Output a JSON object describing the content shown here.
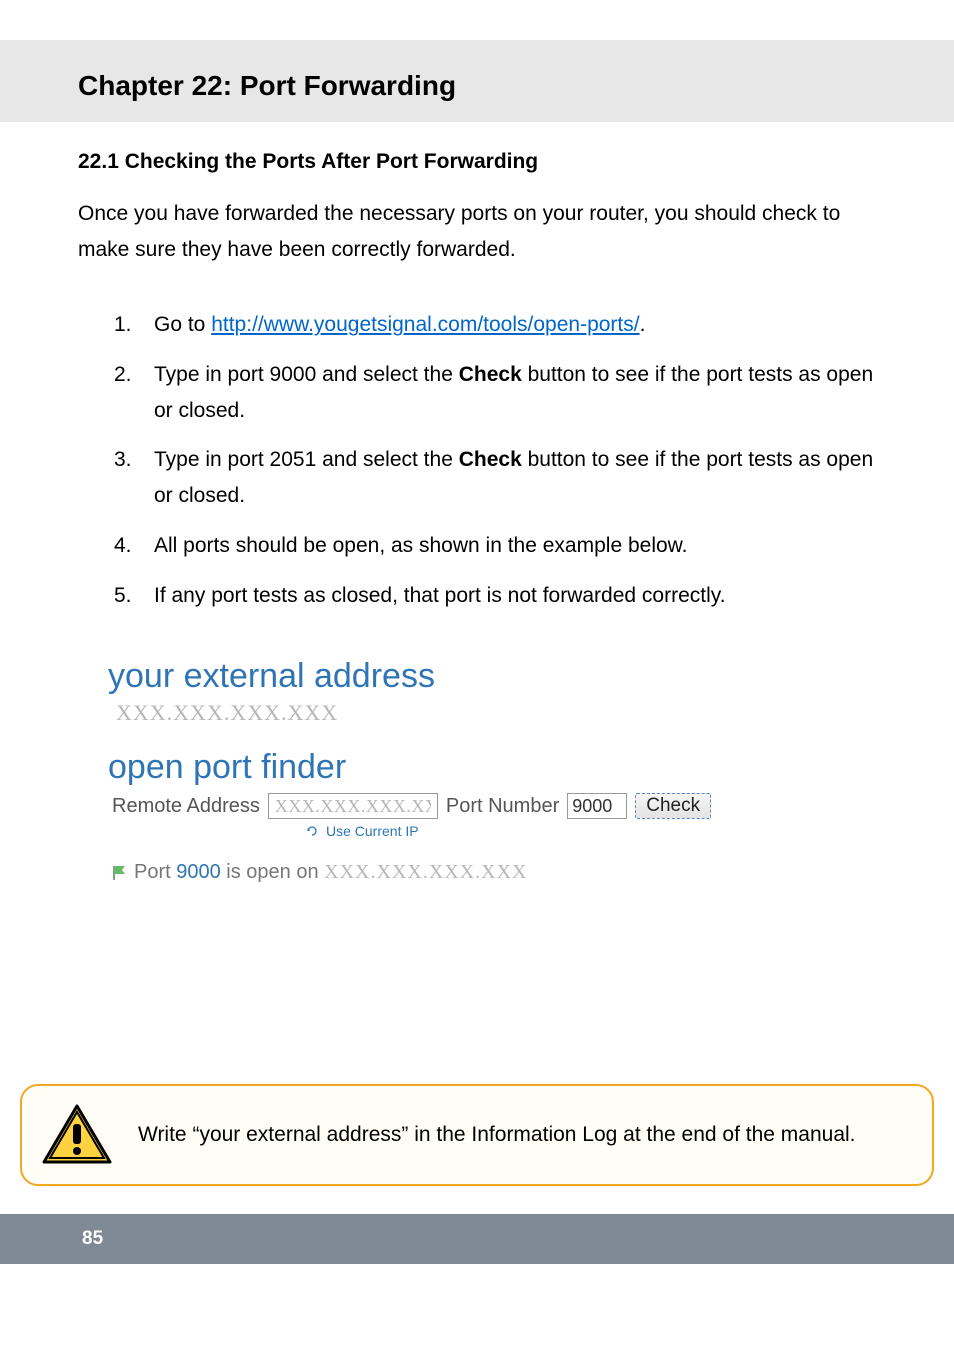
{
  "chapter": {
    "title": "Chapter 22: Port Forwarding"
  },
  "section": {
    "title": "22.1 Checking the Ports After Port Forwarding",
    "intro": "Once you have forwarded the necessary ports on your router, you should check to make sure they have been correctly forwarded."
  },
  "steps": {
    "s1_pre": "Go to ",
    "s1_link": "http://www.yougetsignal.com/tools/open-ports/",
    "s1_post": ".",
    "s2_a": "Type in port 9000 and select the ",
    "s2_b": "Check",
    "s2_c": " button to see if the port tests as open or closed.",
    "s3_a": "Type in port 2051 and select the ",
    "s3_b": "Check",
    "s3_c": " button to see if the port tests as open or closed.",
    "s4": "All ports should be open, as shown in the example below.",
    "s5": "If any port tests as closed, that port is not forwarded correctly."
  },
  "nums": {
    "n1": "1.",
    "n2": "2.",
    "n3": "3.",
    "n4": "4.",
    "n5": "5."
  },
  "screenshot": {
    "ext_title": "your external address",
    "ext_value": "XXX.XXX.XXX.XXX",
    "opf_title": "open port finder",
    "remote_label": "Remote Address",
    "remote_value": "XXX.XXX.XXX.XXX",
    "port_label": "Port Number",
    "port_value": "9000",
    "check_label": "Check",
    "use_current": "Use Current IP",
    "result_prefix": "Port ",
    "result_port": "9000",
    "result_mid": " is open on  ",
    "result_ip": "XXX.XXX.XXX.XXX"
  },
  "warning": {
    "text": "Write “your external address” in the Information Log at the end of the manual."
  },
  "footer": {
    "page_number": "85"
  }
}
